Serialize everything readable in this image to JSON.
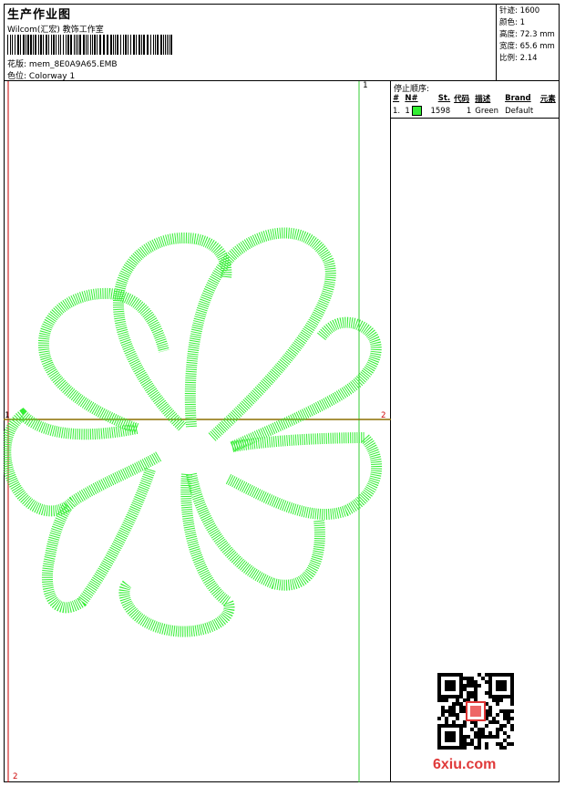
{
  "header": {
    "title": "生产作业图",
    "company": "Wilcom(汇宏) 教饰工作室",
    "design_label": "花版:",
    "design_value": "mem_8E0A9A65.EMB",
    "colorway_label": "色位:",
    "colorway_value": "Colorway 1"
  },
  "stats": [
    {
      "label": "针迹:",
      "value": "1600"
    },
    {
      "label": "颜色:",
      "value": "1"
    },
    {
      "label": "高度:",
      "value": "72.3 mm"
    },
    {
      "label": "宽度:",
      "value": "65.6 mm"
    },
    {
      "label": "比例:",
      "value": "2.14"
    }
  ],
  "stop_sequence": {
    "title": "停止顺序:",
    "columns": [
      "#",
      "N#",
      "St.",
      "代码",
      "描述",
      "Brand",
      "元素"
    ],
    "rows": [
      {
        "index": "1.",
        "needle": "1",
        "stitches": "1598",
        "code": "1",
        "description": "Green",
        "brand": "Default",
        "color": "#33ee33"
      }
    ]
  },
  "markers": {
    "top": "1",
    "left": "1",
    "right": "2",
    "bottom": "2"
  },
  "colors": {
    "thread": "#33ee33",
    "guide_green": "#33cc33",
    "guide_red": "#cc0000",
    "center_line": "#8b6f00"
  },
  "watermark": "6xiu.com",
  "icons": {
    "barcode": "barcode-icon",
    "qr": "qr-code-icon",
    "seal": "seal-icon"
  }
}
